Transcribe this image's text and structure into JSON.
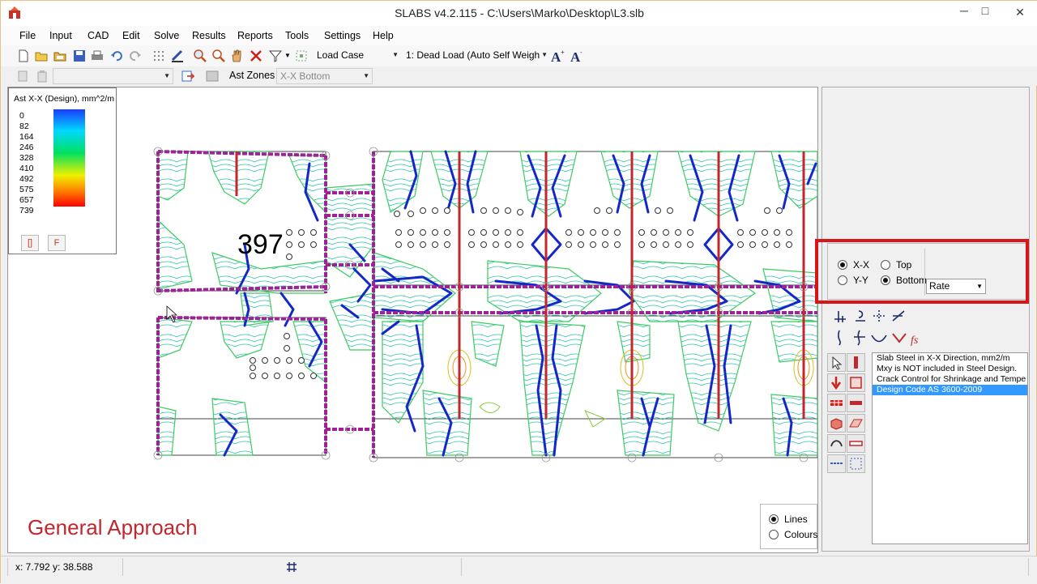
{
  "window": {
    "title": "SLABS v4.2.115 - C:\\Users\\Marko\\Desktop\\L3.slb",
    "minimize": "─",
    "maximize": "□",
    "close": "✕"
  },
  "menu": [
    "File",
    "Input",
    "CAD",
    "Edit",
    "Solve",
    "Results",
    "Reports",
    "Tools",
    "Settings",
    "Help"
  ],
  "toolbar1": {
    "load_case_label": "Load Case",
    "load_case_value": "1: Dead Load (Auto Self Weigh",
    "icons": [
      "new-icon",
      "open-icon",
      "open-folder-icon",
      "save-icon",
      "print-icon",
      "undo-icon",
      "redo-icon",
      "grid-icon",
      "draw-icon",
      "zoom-in-icon",
      "zoom-icon",
      "pan-icon",
      "delete-icon",
      "filter-icon",
      "select-icon",
      "font-size-up-icon",
      "font-size-down-icon"
    ]
  },
  "toolbar2": {
    "empty_combo": "",
    "ast_zones_label": "Ast Zones",
    "ast_zones_value": "X-X Bottom"
  },
  "legend": {
    "title": "Ast X-X (Design), mm^2/m",
    "values": [
      "0",
      "82",
      "164",
      "246",
      "328",
      "410",
      "492",
      "575",
      "657",
      "739"
    ],
    "btn_left": "[]",
    "btn_right": "F"
  },
  "canvas": {
    "big_label": "397",
    "approach_label": "General Approach",
    "plot_mode": {
      "lines": "Lines",
      "colours": "Colours",
      "selected": "Lines"
    }
  },
  "direction": {
    "xx": "X-X",
    "yy": "Y-Y",
    "top": "Top",
    "bottom": "Bottom",
    "selected_dir": "X-X",
    "selected_face": "Bottom",
    "rate_value": "Rate"
  },
  "info": [
    "Slab Steel in X-X Direction, mm2/m",
    "Mxy is NOT included in Steel Design.",
    "Crack Control for Shrinkage and Tempe",
    "Design Code AS 3600-2009"
  ],
  "status": {
    "coords": "x: 7.792   y: 38.588"
  },
  "colors": {
    "accent_red": "#d9141b",
    "contour_blue": "#1428c8",
    "beam_magenta": "#a0209a",
    "selection": "#3399ff"
  }
}
